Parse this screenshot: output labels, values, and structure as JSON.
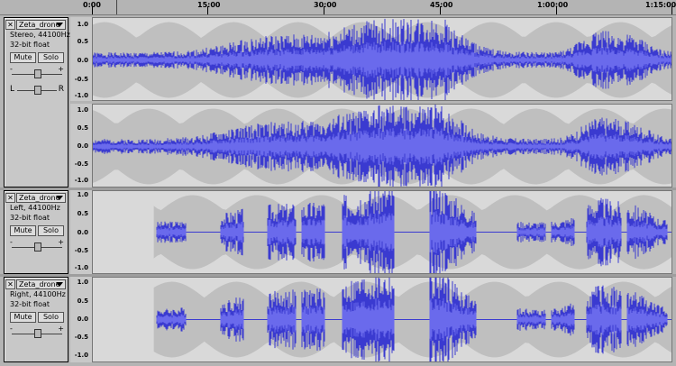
{
  "timeline": {
    "labels": [
      "0:00",
      "15:00",
      "30:00",
      "45:00",
      "1:00:00",
      "1:15:00"
    ]
  },
  "colors": {
    "waveform": "#3a3ad0",
    "waveform_rms": "#6a6aec",
    "envelope": "#bfbfbf",
    "background": "#d9d9d9"
  },
  "tracks": [
    {
      "name": "Zeta_drone",
      "format": "Stereo, 44100Hz",
      "bitdepth": "32-bit float",
      "mute_label": "Mute",
      "solo_label": "Solo",
      "gain_minus": "-",
      "gain_plus": "+",
      "gain_level": 0.5,
      "pan_left": "L",
      "pan_right": "R",
      "pan_level": 0.5,
      "ruler": [
        "1.0",
        "0.5",
        "0.0",
        "-0.5",
        "-1.0"
      ]
    },
    {
      "name": "Zeta_drone",
      "format": "Left, 44100Hz",
      "bitdepth": "32-bit float",
      "mute_label": "Mute",
      "solo_label": "Solo",
      "gain_minus": "-",
      "gain_plus": "+",
      "gain_level": 0.5,
      "ruler": [
        "1.0",
        "0.5",
        "0.0",
        "-0.5",
        "-1.0"
      ]
    },
    {
      "name": "Zeta_drone",
      "format": "Right, 44100Hz",
      "bitdepth": "32-bit float",
      "mute_label": "Mute",
      "solo_label": "Solo",
      "gain_minus": "-",
      "gain_plus": "+",
      "gain_level": 0.5,
      "ruler": [
        "1.0",
        "0.5",
        "0.0",
        "-0.5",
        "-1.0"
      ]
    }
  ],
  "stereo_ruler_lower": [
    "1.0",
    "0.5",
    "0.0",
    "-0.5",
    "-1.0"
  ]
}
